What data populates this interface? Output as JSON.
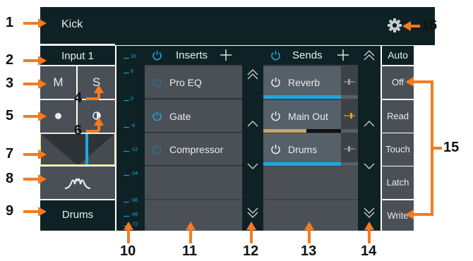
{
  "header": {
    "channel_name": "Kick"
  },
  "strip": {
    "input_label": "Input 1",
    "mute_label": "M",
    "solo_label": "S",
    "bus_label": "Drums"
  },
  "meter": {
    "ticks": [
      "10",
      "6",
      "0",
      "-6",
      "-12",
      "-24",
      "-36",
      "-48",
      "-72"
    ]
  },
  "inserts": {
    "title": "Inserts",
    "items": [
      {
        "name": "Pro EQ",
        "active": false
      },
      {
        "name": "Gate",
        "active": true
      },
      {
        "name": "Compressor",
        "active": false
      }
    ]
  },
  "sends": {
    "title": "Sends",
    "items": [
      {
        "name": "Reverb",
        "level": 1.0,
        "level_color": "#1ea8e0"
      },
      {
        "name": "Main Out",
        "level": 0.55,
        "level_color": "#c9a46a"
      },
      {
        "name": "Drums",
        "level": 1.0,
        "level_color": "#1ea8e0"
      }
    ]
  },
  "automation": {
    "title": "Auto",
    "modes": [
      "Off",
      "Read",
      "Touch",
      "Latch",
      "Write"
    ],
    "selected": "Off"
  },
  "callouts": [
    "1",
    "2",
    "3",
    "4",
    "5",
    "6",
    "7",
    "8",
    "9",
    "10",
    "11",
    "12",
    "13",
    "14",
    "15",
    "16"
  ],
  "colors": {
    "accent": "#1ea8e0",
    "callout": "#f47b20",
    "background": "#3d4248",
    "header": "#0e2226"
  }
}
